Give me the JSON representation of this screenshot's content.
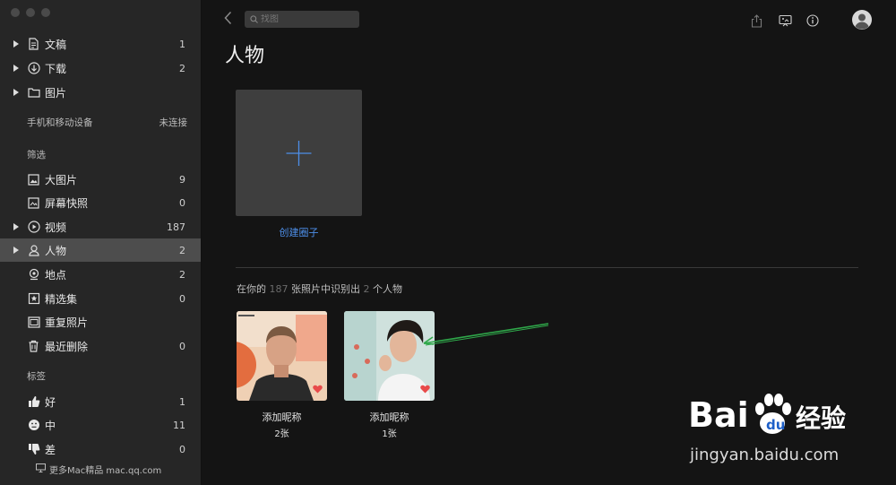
{
  "sidebar": {
    "files": [
      {
        "label": "文稿",
        "count": "1"
      },
      {
        "label": "下载",
        "count": "2"
      },
      {
        "label": "图片",
        "count": ""
      }
    ],
    "devices": {
      "label": "手机和移动设备",
      "status": "未连接"
    },
    "filter_header": "筛选",
    "filters": [
      {
        "label": "大图片",
        "count": "9"
      },
      {
        "label": "屏幕快照",
        "count": "0"
      },
      {
        "label": "视频",
        "count": "187"
      },
      {
        "label": "人物",
        "count": "2"
      },
      {
        "label": "地点",
        "count": "2"
      },
      {
        "label": "精选集",
        "count": "0"
      },
      {
        "label": "重复照片",
        "count": ""
      },
      {
        "label": "最近删除",
        "count": "0"
      }
    ],
    "tags_header": "标签",
    "tags": [
      {
        "label": "好",
        "count": "1"
      },
      {
        "label": "中",
        "count": "11"
      },
      {
        "label": "差",
        "count": "0"
      }
    ],
    "footer": "更多Mac精品 mac.qq.com"
  },
  "toolbar": {
    "search_placeholder": "找图"
  },
  "main": {
    "title": "人物",
    "create_label": "创建圈子",
    "summary": {
      "prefix": "在你的",
      "photo_count": "187",
      "middle": "张照片中识别出",
      "people_count": "2",
      "suffix": "个人物"
    },
    "people": [
      {
        "name": "添加昵称",
        "count": "2张"
      },
      {
        "name": "添加昵称",
        "count": "1张"
      }
    ]
  },
  "watermark": {
    "text": "jingyan.baidu.com",
    "brand": "Bai",
    "brand2": "经验"
  },
  "colors": {
    "accent": "#4d8ee8",
    "sidebar_bg": "#262626",
    "main_bg": "#141414",
    "heart": "#e84a4a"
  }
}
